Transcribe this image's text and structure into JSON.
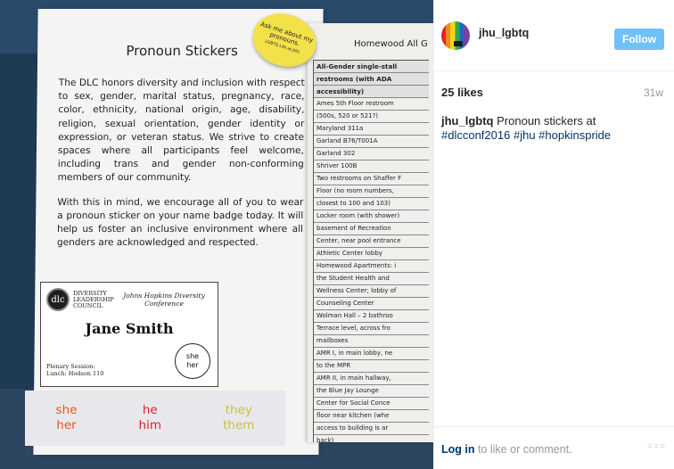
{
  "photo": {
    "left_page": {
      "title": "Pronoun Stickers",
      "paragraphs": [
        "The DLC honors diversity and inclusion with respect to sex, gender, marital status, pregnancy, race, color, ethnicity, national origin, age, disability, religion, sexual orientation, gender identity or expression, or veteran status. We strive to create spaces where all participants feel welcome, including trans and gender non-conforming members of our community.",
        "With this in mind, we encourage all of you to wear a pronoun sticker on your name badge today. It will help us foster an inclusive environment where all genders are acknowledged and respected."
      ],
      "badge": {
        "logo_text": "dlc",
        "org_name": "DIVERSITY LEADERSHIP COUNCIL",
        "conference": "Johns Hopkins Diversity Conference",
        "name": "Jane Smith",
        "session_line_1": "Plenary Session:",
        "session_line_2": "Lunch: Hodson 110",
        "pronoun_1": "she",
        "pronoun_2": "her"
      },
      "stickers": [
        {
          "line1": "she",
          "line2": "her",
          "color": "#e8561c"
        },
        {
          "line1": "he",
          "line2": "him",
          "color": "#d8222a"
        },
        {
          "line1": "they",
          "line2": "them",
          "color": "#c8c23a"
        }
      ]
    },
    "pin": {
      "text": "Ask me about my pronouns.",
      "small": "LGBTQ Life at JHU"
    },
    "right_page": {
      "title": "Homewood All G",
      "rows": [
        {
          "text": "All-Gender single-stall",
          "head": true
        },
        {
          "text": "restrooms (with ADA",
          "head": true
        },
        {
          "text": "accessibility)",
          "head": true
        },
        {
          "text": "Ames 5th Floor restroom",
          "head": false
        },
        {
          "text": "(500s, 520 or 521?)",
          "head": false
        },
        {
          "text": "Maryland 311a",
          "head": false
        },
        {
          "text": "Garland B76/T001A",
          "head": false
        },
        {
          "text": "Garland 302",
          "head": false
        },
        {
          "text": "Shriver 100B",
          "head": false
        },
        {
          "text": "Two restrooms on Shaffer F",
          "head": false
        },
        {
          "text": "Floor (no room numbers,",
          "head": false
        },
        {
          "text": "closest to 100 and 103)",
          "head": false
        },
        {
          "text": "Locker room (with shower)",
          "head": false
        },
        {
          "text": "basement of Recreation",
          "head": false
        },
        {
          "text": "Center, near pool entrance",
          "head": false
        },
        {
          "text": "Athletic Center lobby",
          "head": false
        },
        {
          "text": "Homewood Apartments: i",
          "head": false
        },
        {
          "text": "the Student Health and",
          "head": false
        },
        {
          "text": "Wellness Center; lobby of",
          "head": false
        },
        {
          "text": "Counseling Center",
          "head": false
        },
        {
          "text": "Wolman Hall – 2 bathroo",
          "head": false
        },
        {
          "text": "Terrace level, across fro",
          "head": false
        },
        {
          "text": "mailboxes",
          "head": false
        },
        {
          "text": "AMR I, in main lobby, ne",
          "head": false
        },
        {
          "text": "to the MPR",
          "head": false
        },
        {
          "text": "AMR II, in main hallway,",
          "head": false
        },
        {
          "text": "the Blue Jay Lounge",
          "head": false
        },
        {
          "text": "Center for Social Conce",
          "head": false
        },
        {
          "text": "floor near kitchen (whe",
          "head": false
        },
        {
          "text": "access to building is ar",
          "head": false
        },
        {
          "text": "back)",
          "head": false
        }
      ]
    }
  },
  "panel": {
    "username": "jhu_lgbtq",
    "follow_label": "Follow",
    "likes": "25 likes",
    "age": "31w",
    "caption_user": "jhu_lgbtq",
    "caption_text": "Pronoun stickers at",
    "hashtags": [
      "#dlcconf2016",
      "#jhu",
      "#hopkinspride"
    ],
    "login_link": "Log in",
    "login_rest": "to like or comment.",
    "more_label": "○○○",
    "colors": {
      "follow_bg": "#70c1f8",
      "link": "#003569",
      "muted": "#999999"
    },
    "icons": [
      "avatar-rainbow-icon",
      "more-options-icon"
    ]
  }
}
